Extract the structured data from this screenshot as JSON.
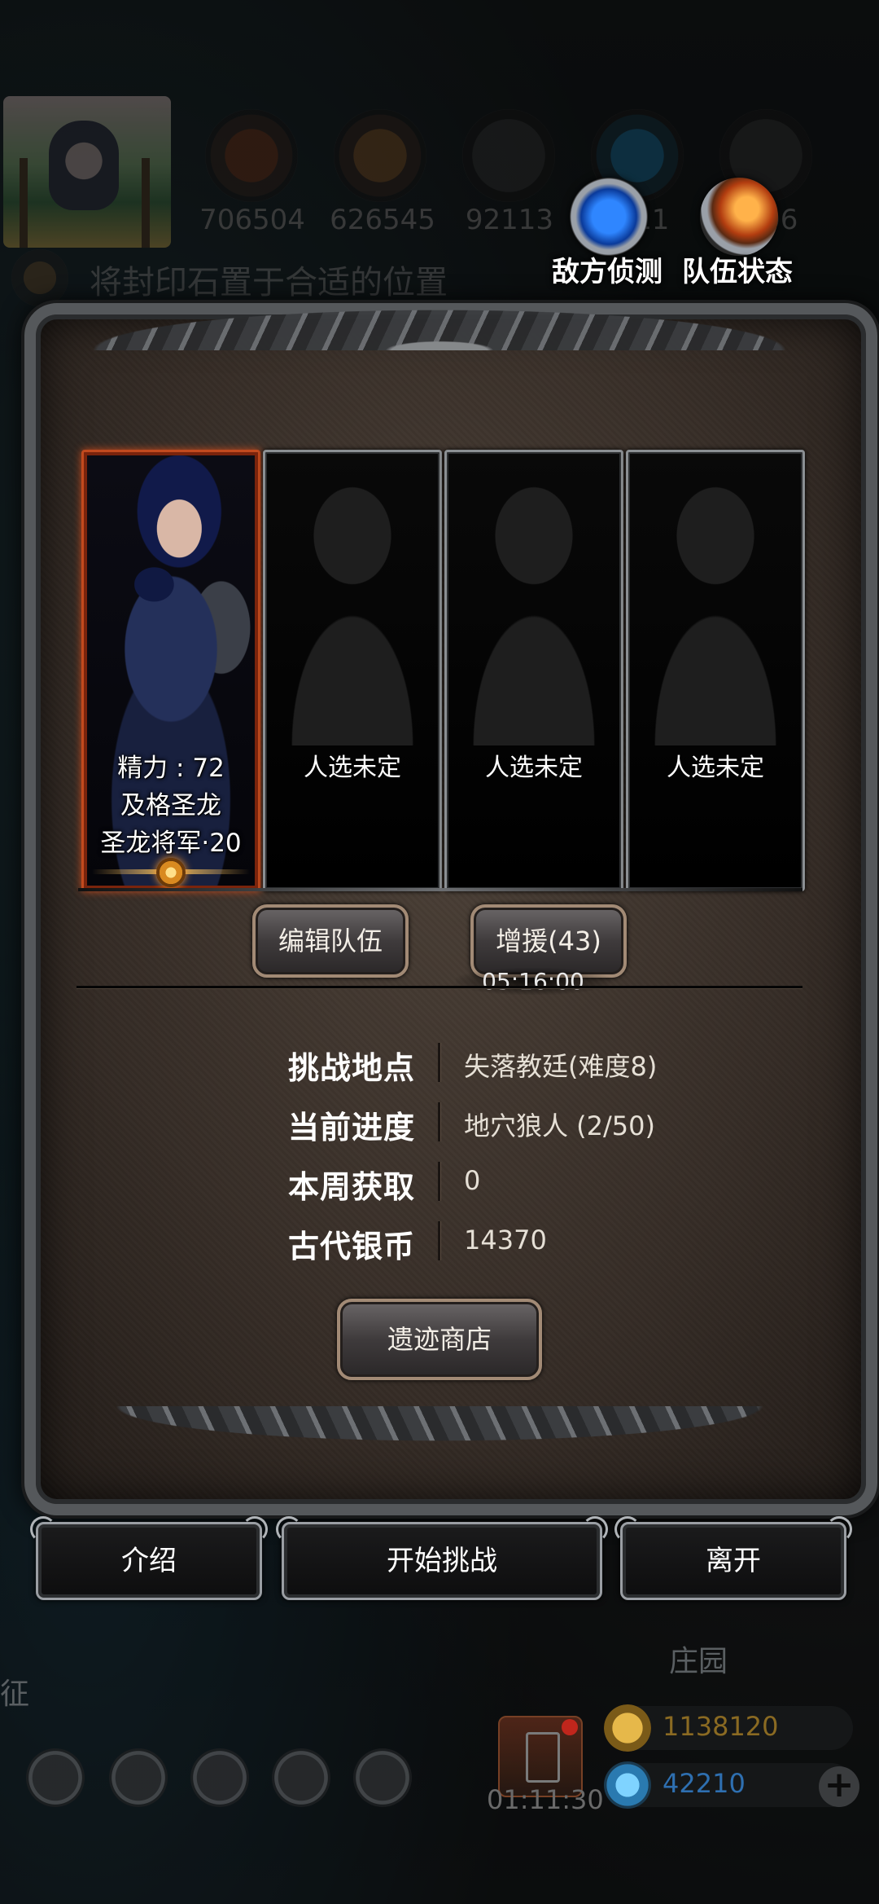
{
  "hud": {
    "resources": [
      {
        "icon": "meat-icon",
        "value": "706504"
      },
      {
        "icon": "wood-icon",
        "value": "626545"
      },
      {
        "icon": "iron-icon",
        "value": "92113"
      },
      {
        "icon": "feather-icon",
        "value": "311"
      },
      {
        "icon": "claw-icon",
        "value": "006"
      }
    ],
    "enemy_scout_label": "敌方侦测",
    "team_status_label": "队伍状态",
    "hint_text": "将封印石置于合适的位置"
  },
  "team": {
    "slots": [
      {
        "filled": true,
        "stamina": "精力 : 72",
        "name": "及格圣龙",
        "title": "圣龙将军·20"
      },
      {
        "filled": false,
        "label": "人选未定"
      },
      {
        "filled": false,
        "label": "人选未定"
      },
      {
        "filled": false,
        "label": "人选未定"
      }
    ],
    "edit_team_label": "编辑队伍",
    "reinforce_label": "增援(43)",
    "reinforce_timer": "05:16:00"
  },
  "info": {
    "rows": [
      {
        "label": "挑战地点",
        "value": "失落教廷(难度8)"
      },
      {
        "label": "当前进度",
        "value": "地穴狼人 (2/50)"
      },
      {
        "label": "本周获取",
        "value": "0"
      },
      {
        "label": "古代银币",
        "value": "14370"
      }
    ],
    "shop_label": "遗迹商店"
  },
  "actions": {
    "intro_label": "介绍",
    "start_label": "开始挑战",
    "leave_label": "离开"
  },
  "background": {
    "manor_label": "庄园",
    "expedition_label": "征",
    "gift_timer": "01:11:30",
    "gold": "1138120",
    "gems": "42210"
  },
  "colors": {
    "accent_orange": "#c24a1e",
    "frame_gray": "#8b8f93",
    "gold_text": "#8a6a22",
    "gem_text": "#2e6fb0"
  }
}
